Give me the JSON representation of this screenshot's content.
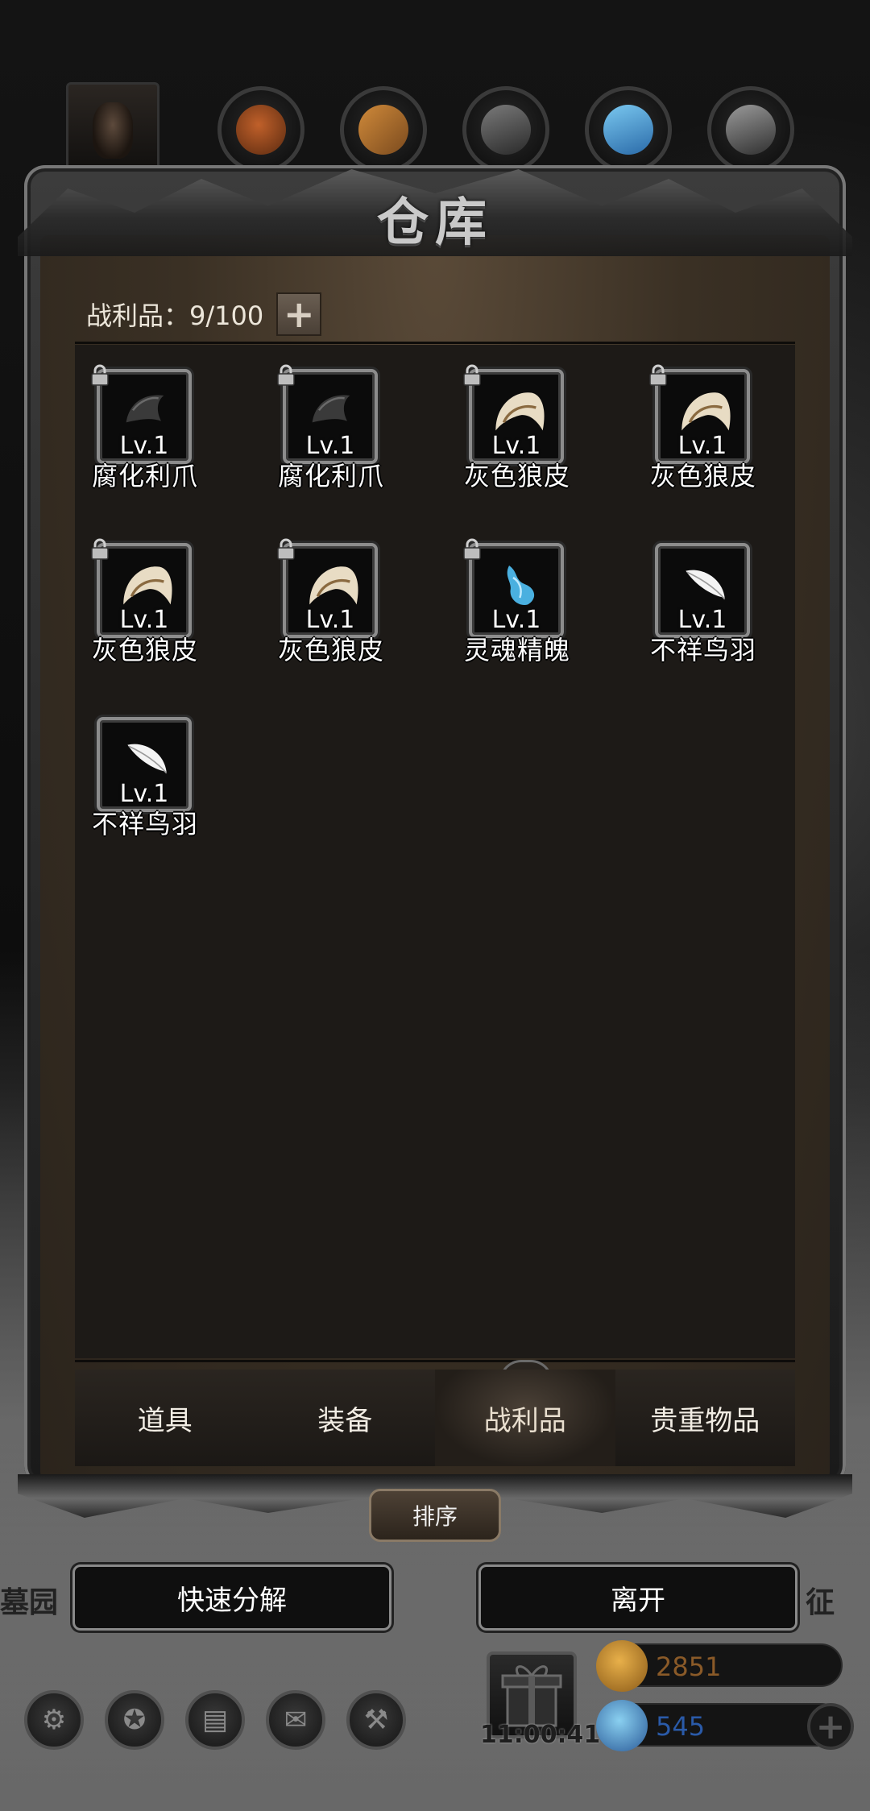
{
  "dialog": {
    "title": "仓库",
    "counter_label": "战利品：9/100",
    "expand_icon": "+"
  },
  "items": [
    {
      "name": "腐化利爪",
      "level": "Lv.1",
      "locked": true,
      "icon": "claw-icon"
    },
    {
      "name": "腐化利爪",
      "level": "Lv.1",
      "locked": true,
      "icon": "claw-icon"
    },
    {
      "name": "灰色狼皮",
      "level": "Lv.1",
      "locked": true,
      "icon": "wolf-pelt-icon"
    },
    {
      "name": "灰色狼皮",
      "level": "Lv.1",
      "locked": true,
      "icon": "wolf-pelt-icon"
    },
    {
      "name": "灰色狼皮",
      "level": "Lv.1",
      "locked": true,
      "icon": "wolf-pelt-icon"
    },
    {
      "name": "灰色狼皮",
      "level": "Lv.1",
      "locked": true,
      "icon": "wolf-pelt-icon"
    },
    {
      "name": "灵魂精魄",
      "level": "Lv.1",
      "locked": true,
      "icon": "soul-essence-icon"
    },
    {
      "name": "不祥鸟羽",
      "level": "Lv.1",
      "locked": false,
      "icon": "feather-icon"
    },
    {
      "name": "不祥鸟羽",
      "level": "Lv.1",
      "locked": false,
      "icon": "feather-icon"
    }
  ],
  "category_tabs": [
    {
      "label": "道具",
      "active": false
    },
    {
      "label": "装备",
      "active": false
    },
    {
      "label": "战利品",
      "active": true
    },
    {
      "label": "贵重物品",
      "active": false
    }
  ],
  "sort_label": "排序",
  "actions": {
    "quick_decompose": "快速分解",
    "leave": "离开"
  },
  "side_labels": {
    "left": "墓园",
    "right": "征"
  },
  "bottom": {
    "gift_timer": "11:00:41",
    "gold": "2851",
    "gems": "545"
  },
  "colors": {
    "gold_text": "#8a5a28",
    "gem_text": "#2a5aa8",
    "active_tab": "#e9dfcf"
  }
}
